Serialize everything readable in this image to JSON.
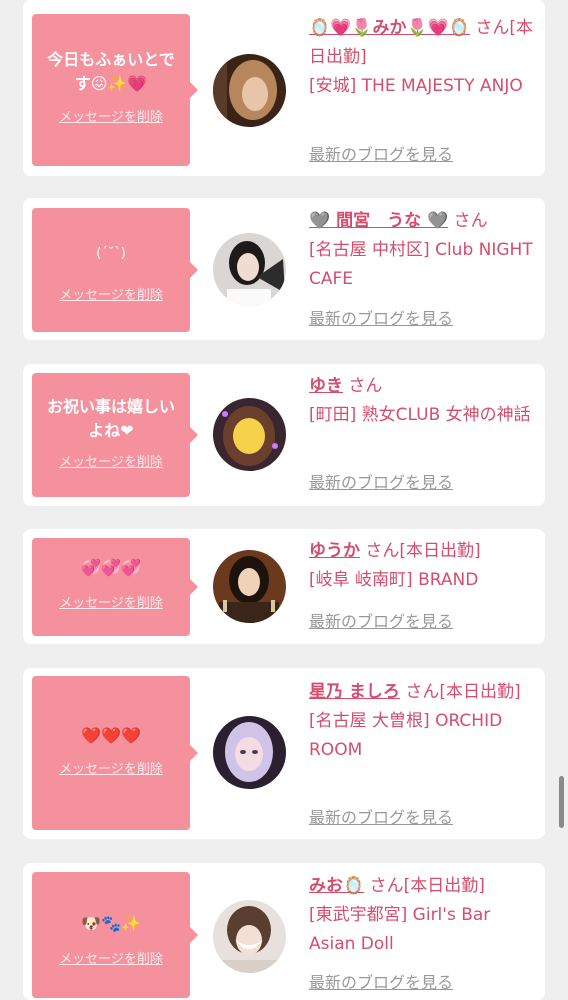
{
  "common": {
    "delete_label": "メッセージを削除",
    "blog_label": "最新のブログを見る"
  },
  "items": [
    {
      "message": "今日もふぁいとで\nす😖✨💗",
      "name": "🪞💗🌷みか🌷💗🪞",
      "suffix": "さん[本日出勤]",
      "shop": "[安城] THE MAJESTY ANJO"
    },
    {
      "message": "(ˊ˘ˋ)",
      "name": "🩶 間宮　うな 🩶",
      "suffix": "さん",
      "shop": "[名古屋 中村区] Club NIGHT CAFE"
    },
    {
      "message": "お祝い事は嬉しい\nよね❤",
      "name": "ゆき",
      "suffix": "さん",
      "shop": "[町田] 熟女CLUB 女神の神話"
    },
    {
      "message": "💞💞💞",
      "name": "ゆうか",
      "suffix": "さん[本日出勤]",
      "shop": "[岐阜 岐南町] BRAND"
    },
    {
      "message": "❤️❤️❤️",
      "name": "星乃 ましろ",
      "suffix": "さん[本日出勤]",
      "shop": "[名古屋 大曽根] ORCHID ROOM"
    },
    {
      "message": "🐶🐾✨",
      "name": "みお🪞",
      "suffix": "さん[本日出勤]",
      "shop": "[東武宇都宮] Girl's Bar Asian Doll"
    }
  ]
}
